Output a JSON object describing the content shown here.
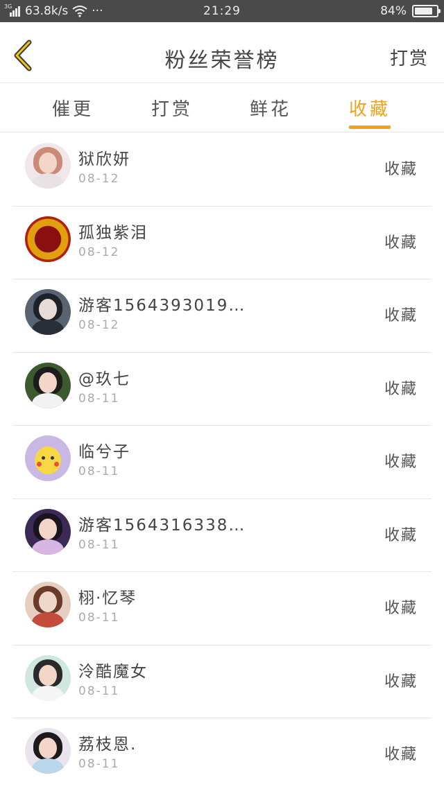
{
  "status_bar": {
    "network": "3G",
    "speed": "63.8k/s",
    "dots": "···",
    "time": "21:29",
    "battery_text": "84%",
    "battery_level": 0.84,
    "icons": [
      "signal-icon",
      "wifi-icon",
      "battery-icon"
    ]
  },
  "header": {
    "back_icon": "chevron-left-icon",
    "title": "粉丝荣誉榜",
    "action_label": "打赏"
  },
  "tabs": [
    {
      "label": "催更",
      "active": false
    },
    {
      "label": "打赏",
      "active": false
    },
    {
      "label": "鲜花",
      "active": false
    },
    {
      "label": "收藏",
      "active": true
    }
  ],
  "colors": {
    "accent": "#f2a11c",
    "status_bar_bg": "#4a4a4a",
    "divider": "#e6e6e6",
    "date_text": "#aaaaaa"
  },
  "list": [
    {
      "name": "狱欣妍",
      "date": "08-12",
      "action": "收藏"
    },
    {
      "name": "孤独紫泪",
      "date": "08-12",
      "action": "收藏"
    },
    {
      "name": "游客1564393019…",
      "date": "08-12",
      "action": "收藏"
    },
    {
      "name": "@玖七",
      "date": "08-11",
      "action": "收藏"
    },
    {
      "name": "临兮子",
      "date": "08-11",
      "action": "收藏"
    },
    {
      "name": "游客1564316338…",
      "date": "08-11",
      "action": "收藏"
    },
    {
      "name": "栩·忆琴",
      "date": "08-11",
      "action": "收藏"
    },
    {
      "name": "泠酷魔女",
      "date": "08-11",
      "action": "收藏"
    },
    {
      "name": "荔枝恩.",
      "date": "08-11",
      "action": "收藏"
    }
  ]
}
